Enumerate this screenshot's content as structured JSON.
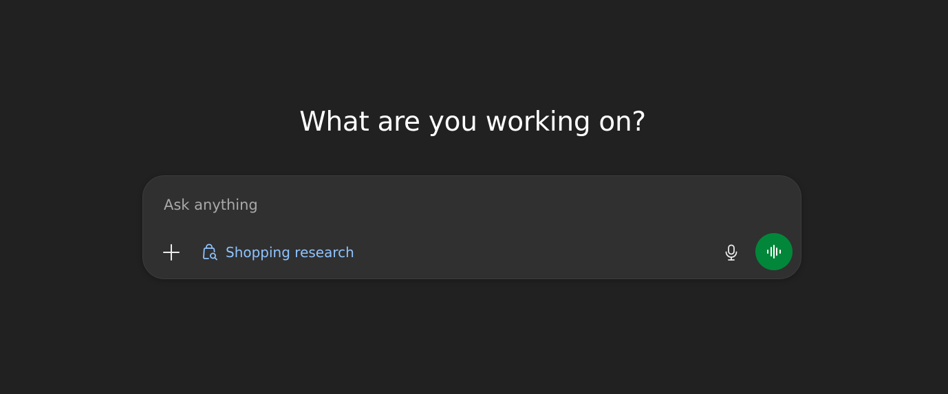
{
  "heading": "What are you working on?",
  "composer": {
    "placeholder": "Ask anything",
    "value": "",
    "add_icon": "plus-icon",
    "tool_chip": {
      "label": "Shopping research",
      "icon": "shopping-bag-search-icon",
      "color": "#8fc3ff"
    },
    "mic_icon": "microphone-icon",
    "voice_icon": "voice-waveform-icon",
    "voice_button_color": "#02873a"
  },
  "colors": {
    "background": "#212121",
    "composer_background": "#303030"
  }
}
